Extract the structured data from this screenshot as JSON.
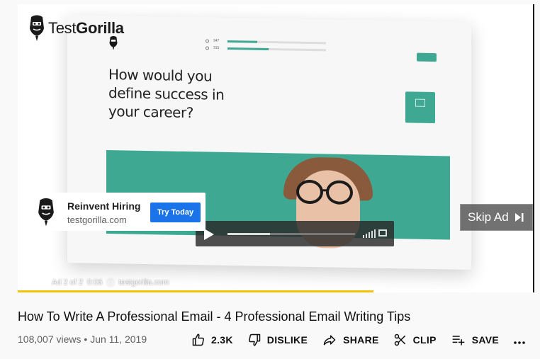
{
  "logo": {
    "brand_light": "Test",
    "brand_bold": "Gorilla"
  },
  "video_scene": {
    "question": "How would you define success in your career?",
    "mini_stats": [
      "347",
      "315"
    ]
  },
  "ad_card": {
    "title": "Reinvent Hiring",
    "domain": "testgorilla.com",
    "cta": "Try Today"
  },
  "skip": {
    "label": "Skip Ad"
  },
  "ad_meta": {
    "position": "Ad 2 of 2",
    "time": "0:06",
    "url": "testgorilla.com"
  },
  "progress": {
    "fraction": 0.69,
    "color": "#f2c307"
  },
  "video": {
    "title": "How To Write A Professional Email - 4 Professional Email Writing Tips",
    "views": "108,007 views",
    "date": "Jun 11, 2019"
  },
  "actions": {
    "like_count": "2.3K",
    "dislike_label": "DISLIKE",
    "share_label": "SHARE",
    "clip_label": "CLIP",
    "save_label": "SAVE"
  },
  "colors": {
    "teal": "#3fa892",
    "cta_blue": "#1a73e8"
  }
}
